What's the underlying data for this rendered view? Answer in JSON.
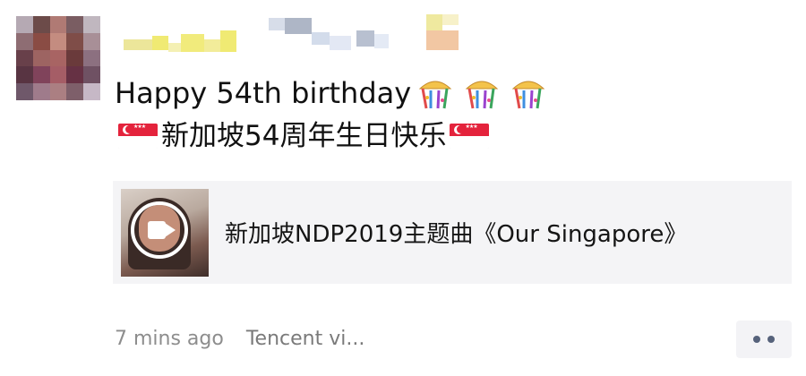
{
  "post": {
    "author_name": "",
    "line1_text": "Happy 54th birthday",
    "line2_text": "新加坡54周年生日快乐"
  },
  "icons": {
    "avatar": "blurred-avatar",
    "party": "party-popper-icon",
    "flag": "singapore-flag-icon",
    "menu": "more-options-icon",
    "video": "video-camera-icon"
  },
  "link_card": {
    "title": "新加坡NDP2019主题曲《Our Singapore》"
  },
  "meta": {
    "time_ago": "7 mins ago",
    "source": "Tencent vi..."
  }
}
